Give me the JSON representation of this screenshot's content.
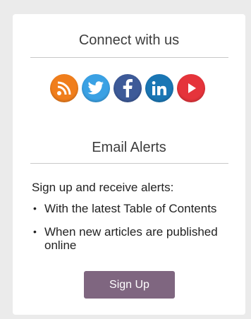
{
  "connect": {
    "title": "Connect with us",
    "icons": [
      {
        "name": "rss-icon",
        "color": "#f07e1c"
      },
      {
        "name": "twitter-icon",
        "color": "#3aa1e4"
      },
      {
        "name": "facebook-icon",
        "color": "#3d5a98"
      },
      {
        "name": "linkedin-icon",
        "color": "#1a76b4"
      },
      {
        "name": "youtube-icon",
        "color": "#e5343b"
      }
    ]
  },
  "alerts": {
    "title": "Email Alerts",
    "intro": "Sign up and receive alerts:",
    "bullets": [
      "With the latest Table of Contents",
      "When new articles are published online"
    ],
    "bullet_glyph": "•",
    "signup_label": "Sign Up",
    "signup_color": "#7f6680"
  }
}
